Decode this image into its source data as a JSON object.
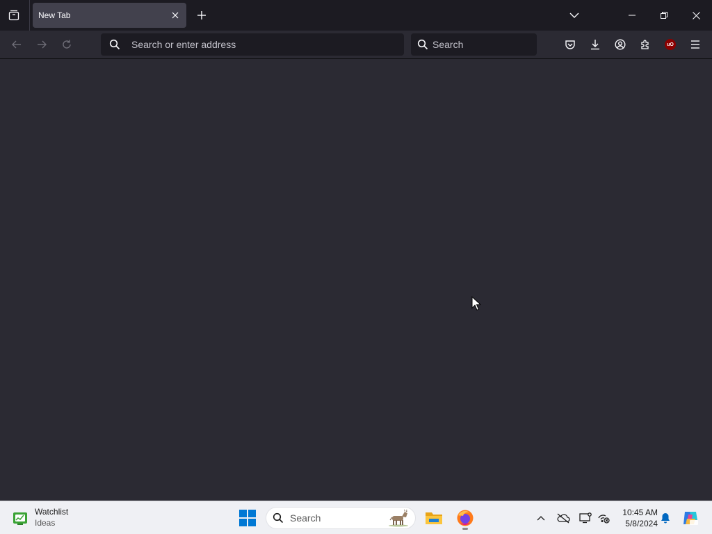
{
  "browser": {
    "active_tab": {
      "title": "New Tab"
    },
    "urlbar": {
      "placeholder": "Search or enter address",
      "value": ""
    },
    "searchbar": {
      "placeholder": "Search",
      "value": ""
    },
    "ublock_badge": "uO"
  },
  "icons": {
    "titlebar": [
      "tab-list-icon",
      "close-icon",
      "plus-icon",
      "chevron-down-icon",
      "minimize-icon",
      "restore-icon",
      "close-icon"
    ],
    "navbar": [
      "back-arrow-icon",
      "forward-arrow-icon",
      "reload-icon",
      "search-icon",
      "pocket-icon",
      "download-icon",
      "account-icon",
      "extensions-icon",
      "ublock-icon",
      "hamburger-menu-icon"
    ],
    "taskbar": [
      "watchlist-icon",
      "windows-start-icon",
      "search-icon",
      "file-explorer-icon",
      "firefox-icon",
      "chevron-up-icon",
      "onedrive-icon",
      "display-icon",
      "network-icon",
      "bell-icon",
      "copilot-icon"
    ]
  },
  "taskbar": {
    "widget": {
      "title": "Watchlist",
      "subtitle": "Ideas"
    },
    "search": {
      "placeholder": "Search"
    },
    "clock": {
      "time": "10:45 AM",
      "date": "5/8/2024"
    }
  },
  "colors": {
    "chrome_dark": "#1c1b22",
    "content_bg": "#2b2a33",
    "tab_active": "#42414d",
    "taskbar_bg": "#eff0f4",
    "windows_blue": "#0078d4"
  }
}
